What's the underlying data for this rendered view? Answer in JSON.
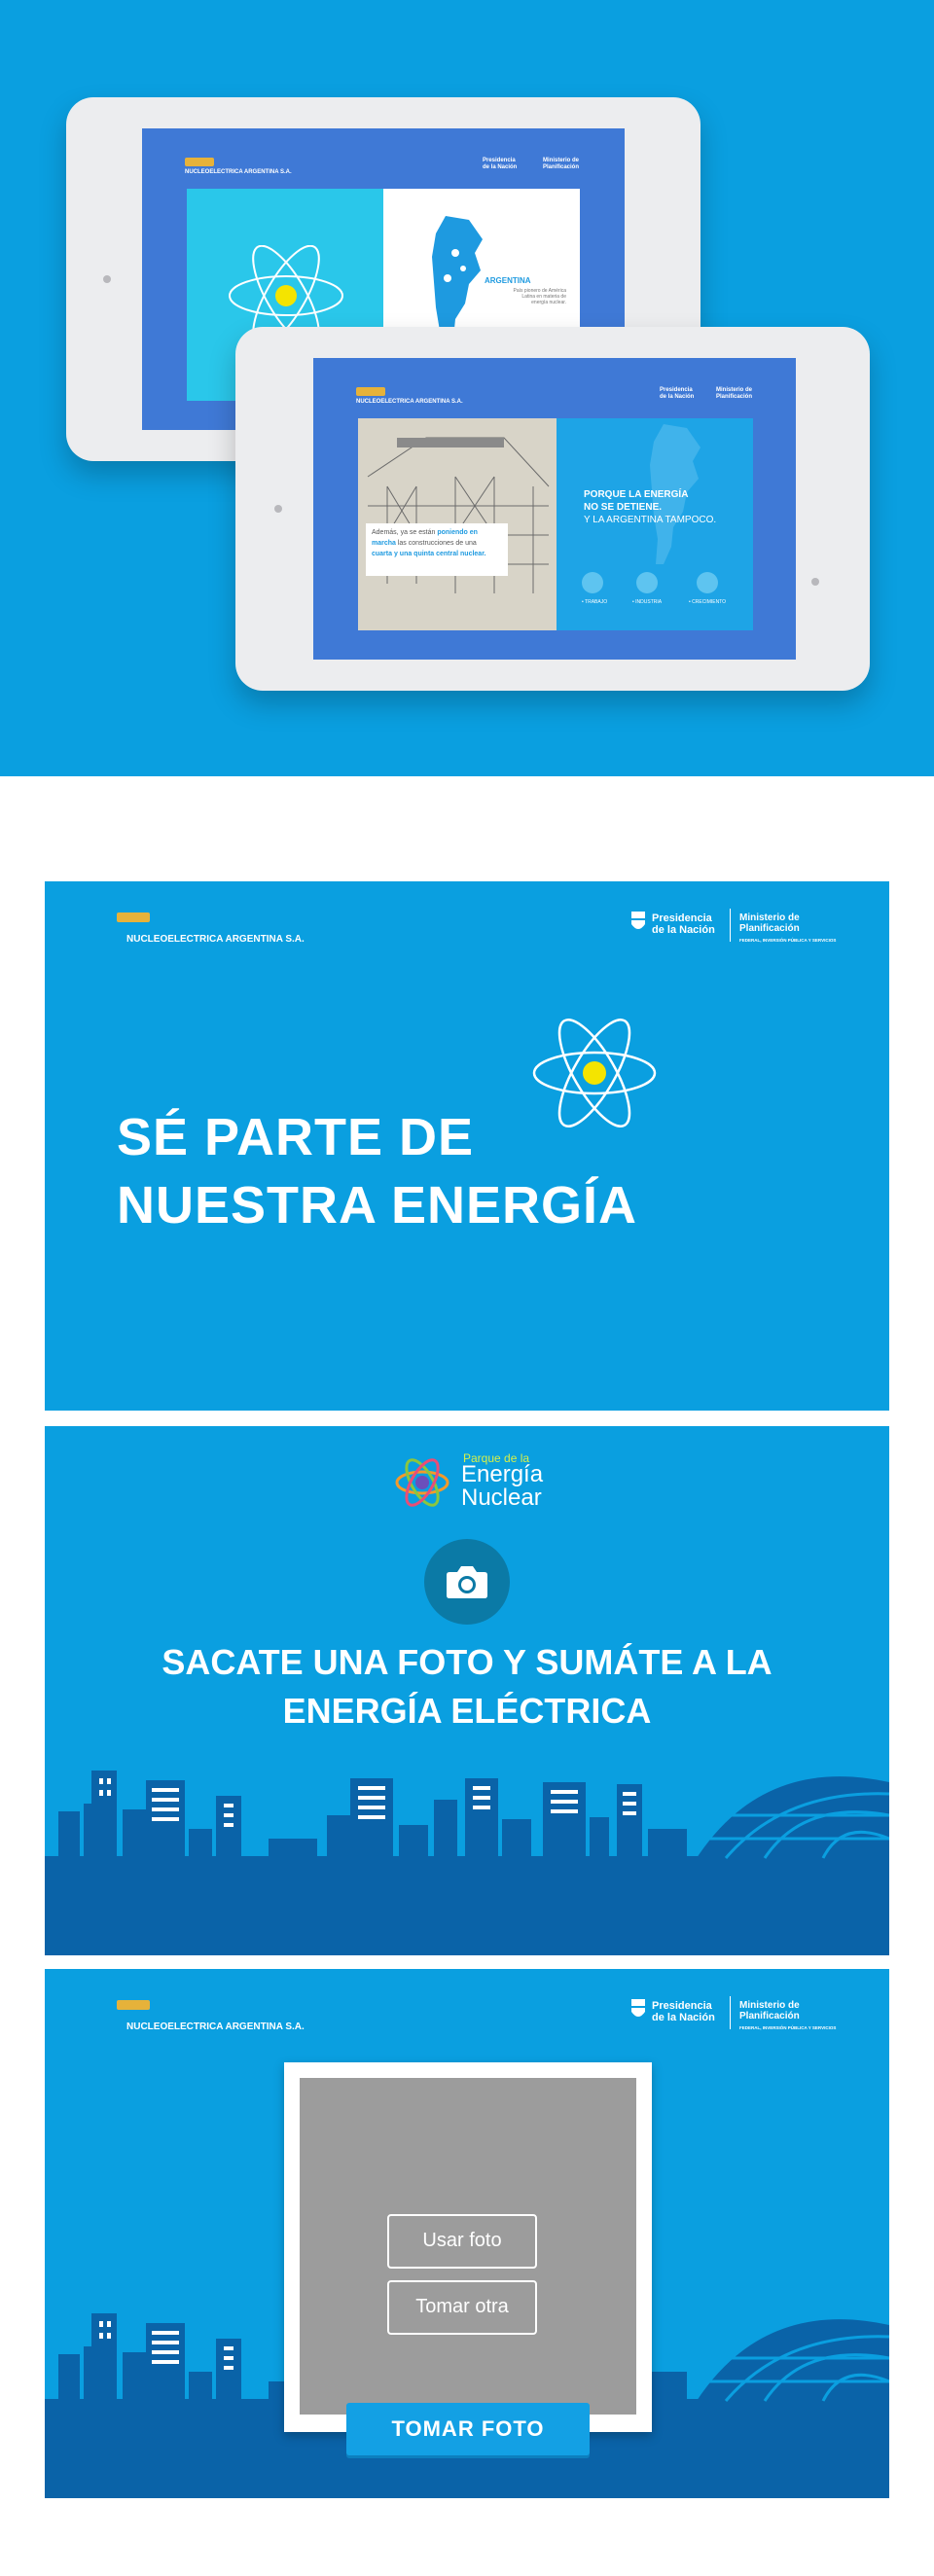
{
  "colors": {
    "brand_blue": "#0a9fe0",
    "screen_blue": "#3f79d6",
    "dark_blue": "#0a63a8",
    "yellow": "#f4e400"
  },
  "brand": {
    "company": "NUCLEOELECTRICA ARGENTINA S.A.",
    "gov_line1": "Presidencia",
    "gov_line2": "de la Nación",
    "ministry_line1": "Ministerio de",
    "ministry_line2": "Planificación",
    "ministry_line3": "FEDERAL, INVERSIÓN PÚBLICA Y SERVICIOS"
  },
  "hero": {
    "tablet1": {
      "map_title": "ARGENTINA",
      "map_caption_1": "País pionero de América",
      "map_caption_2": "Latina en materia de",
      "map_caption_3": "energía nuclear."
    },
    "tablet2": {
      "caption_1": "Además, ya se están",
      "caption_1b": "poniendo en",
      "caption_2": "marcha",
      "caption_2b": "las construcciones de una",
      "caption_3": "cuarta y una quinta central nuclear.",
      "headline_1": "PORQUE LA ENERGÍA",
      "headline_2": "NO SE DETIENE.",
      "headline_3": "Y LA ARGENTINA TAMPOCO.",
      "icons": [
        {
          "label": "• TRABAJO",
          "icon": "work-icon"
        },
        {
          "label": "• INDUSTRIA",
          "icon": "industry-icon"
        },
        {
          "label": "• CRECIMIENTO",
          "icon": "growth-icon"
        }
      ]
    }
  },
  "panel1": {
    "title_line1": "SÉ PARTE DE",
    "title_line2": "NUESTRA ENERGÍA"
  },
  "panel2": {
    "logo_small": "Parque de la",
    "logo_big_1": "Energía",
    "logo_big_2": "Nuclear",
    "title_line1": "SACATE UNA FOTO Y SUMÁTE A LA",
    "title_line2": "ENERGÍA ELÉCTRICA",
    "camera_icon": "camera-icon"
  },
  "panel3": {
    "use_photo": "Usar foto",
    "retake": "Tomar otra",
    "take_photo": "TOMAR FOTO"
  }
}
